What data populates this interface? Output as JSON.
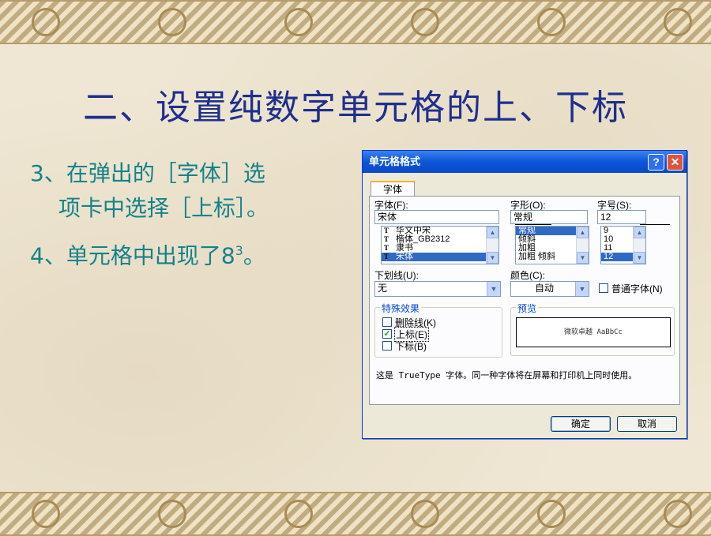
{
  "slide": {
    "title": "二、设置纯数字单元格的上、下标",
    "bullets": {
      "b1_line1": "3、在弹出的［字体］选",
      "b1_line2": "项卡中选择［上标］。",
      "b2_text": "4、单元格中出现了8",
      "b2_sup": "3",
      "b2_end": "。"
    }
  },
  "dialog": {
    "title": "单元格格式",
    "help_btn": "?",
    "close_btn": "✕",
    "tab": "字体",
    "font_label": "字体(F):",
    "font_value": "宋体",
    "font_list": [
      "华文中宋",
      "楷体_GB2312",
      "隶书",
      "宋体"
    ],
    "font_selected_index": 3,
    "style_label": "字形(O):",
    "style_value": "常规",
    "style_list": [
      "常规",
      "倾斜",
      "加粗",
      "加粗 倾斜"
    ],
    "style_selected_index": 0,
    "size_label": "字号(S):",
    "size_value": "12",
    "size_list": [
      "9",
      "10",
      "11",
      "12"
    ],
    "size_selected_index": 3,
    "underline_label": "下划线(U):",
    "underline_value": "无",
    "color_label": "颜色(C):",
    "color_value": "自动",
    "normal_font_label": "普通字体(N)",
    "effects_label": "特殊效果",
    "strikethrough_label": "删除线(K)",
    "superscript_label": "上标(E)",
    "subscript_label": "下标(B)",
    "strikethrough_checked": false,
    "superscript_checked": true,
    "subscript_checked": false,
    "preview_label": "预览",
    "preview_text": "微软卓越  AaBbCc",
    "info_text": "这是 TrueType 字体。同一种字体将在屏幕和打印机上同时使用。",
    "ok_label": "确定",
    "cancel_label": "取消"
  },
  "colors": {
    "title_blue": "#1f2f8e",
    "bullet_teal": "#14828a",
    "xp_titlebar": "#0b55d8",
    "selection": "#316ac5"
  }
}
